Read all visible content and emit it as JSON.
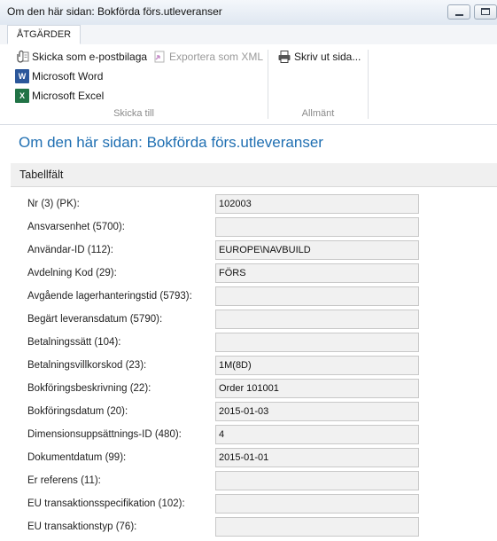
{
  "window": {
    "title": "Om den här sidan: Bokförda förs.utleveranser"
  },
  "ribbon": {
    "tab": "ÅTGÄRDER",
    "send_group": {
      "label": "Skicka till",
      "email": "Skicka som e-postbilaga",
      "export_xml": "Exportera som XML",
      "word": "Microsoft Word",
      "excel": "Microsoft Excel"
    },
    "general_group": {
      "label": "Allmänt",
      "print": "Skriv ut sida..."
    }
  },
  "page": {
    "heading": "Om den här sidan: Bokförda förs.utleveranser",
    "section": "Tabellfält"
  },
  "fields": [
    {
      "label": "Nr (3) (PK):",
      "value": "102003"
    },
    {
      "label": "Ansvarsenhet (5700):",
      "value": ""
    },
    {
      "label": "Användar-ID (112):",
      "value": "EUROPE\\NAVBUILD"
    },
    {
      "label": "Avdelning Kod (29):",
      "value": "FÖRS"
    },
    {
      "label": "Avgående lagerhanteringstid (5793):",
      "value": ""
    },
    {
      "label": "Begärt leveransdatum (5790):",
      "value": ""
    },
    {
      "label": "Betalningssätt (104):",
      "value": ""
    },
    {
      "label": "Betalningsvillkorskod (23):",
      "value": "1M(8D)"
    },
    {
      "label": "Bokföringsbeskrivning (22):",
      "value": "Order 101001"
    },
    {
      "label": "Bokföringsdatum (20):",
      "value": "2015-01-03"
    },
    {
      "label": "Dimensionsuppsättnings-ID (480):",
      "value": "4"
    },
    {
      "label": "Dokumentdatum (99):",
      "value": "2015-01-01"
    },
    {
      "label": "Er referens (11):",
      "value": ""
    },
    {
      "label": "EU transaktionsspecifikation (102):",
      "value": ""
    },
    {
      "label": "EU transaktionstyp (76):",
      "value": ""
    }
  ]
}
